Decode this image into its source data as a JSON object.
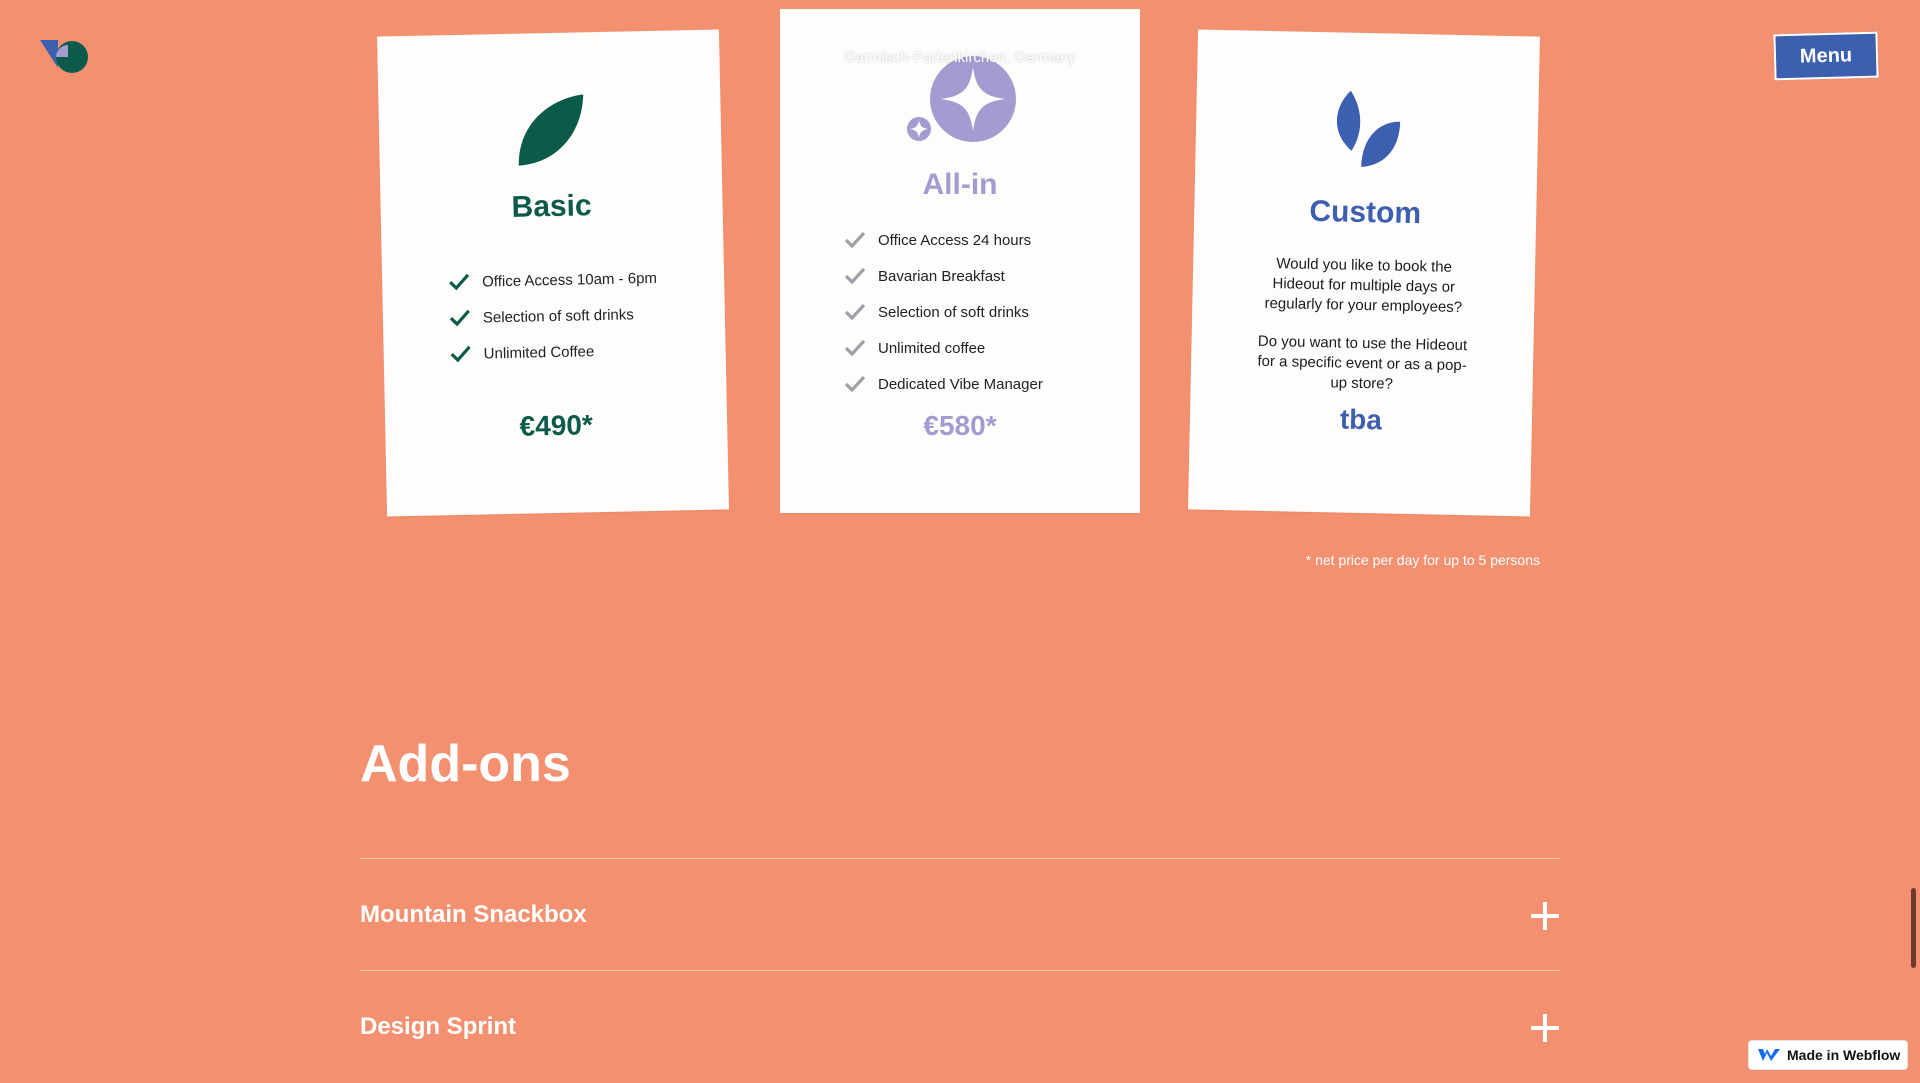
{
  "header": {
    "menu_label": "Menu"
  },
  "cards": {
    "basic": {
      "title": "Basic",
      "features": [
        "Office Access 10am - 6pm",
        "Selection of soft drinks",
        "Unlimited Coffee"
      ],
      "price": "€490*",
      "accent": "#0c5a4a"
    },
    "allin": {
      "overlay_text": "Garmisch-Partenkirchen, Germany",
      "title": "All-in",
      "features": [
        "Office Access 24 hours",
        "Bavarian Breakfast",
        "Selection of soft drinks",
        "Unlimited coffee",
        "Dedicated Vibe Manager"
      ],
      "price": "€580*",
      "accent": "#a59bd0"
    },
    "custom": {
      "title": "Custom",
      "paragraph_1": "Would you like to book the Hideout for multiple days or regularly for your employees?",
      "paragraph_2": "Do you want to use the Hideout for a specific event or as a pop-up store?",
      "price": "tba",
      "accent": "#3d5fb0"
    }
  },
  "price_note": "* net price per day for up to 5 persons",
  "addons": {
    "title": "Add-ons",
    "items": [
      {
        "label": "Mountain Snackbox"
      },
      {
        "label": "Design Sprint"
      }
    ]
  },
  "webflow_badge": "Made in Webflow",
  "colors": {
    "background": "#f3906f",
    "basic": "#0c5a4a",
    "allin": "#a59bd0",
    "custom": "#3d5fb0"
  }
}
